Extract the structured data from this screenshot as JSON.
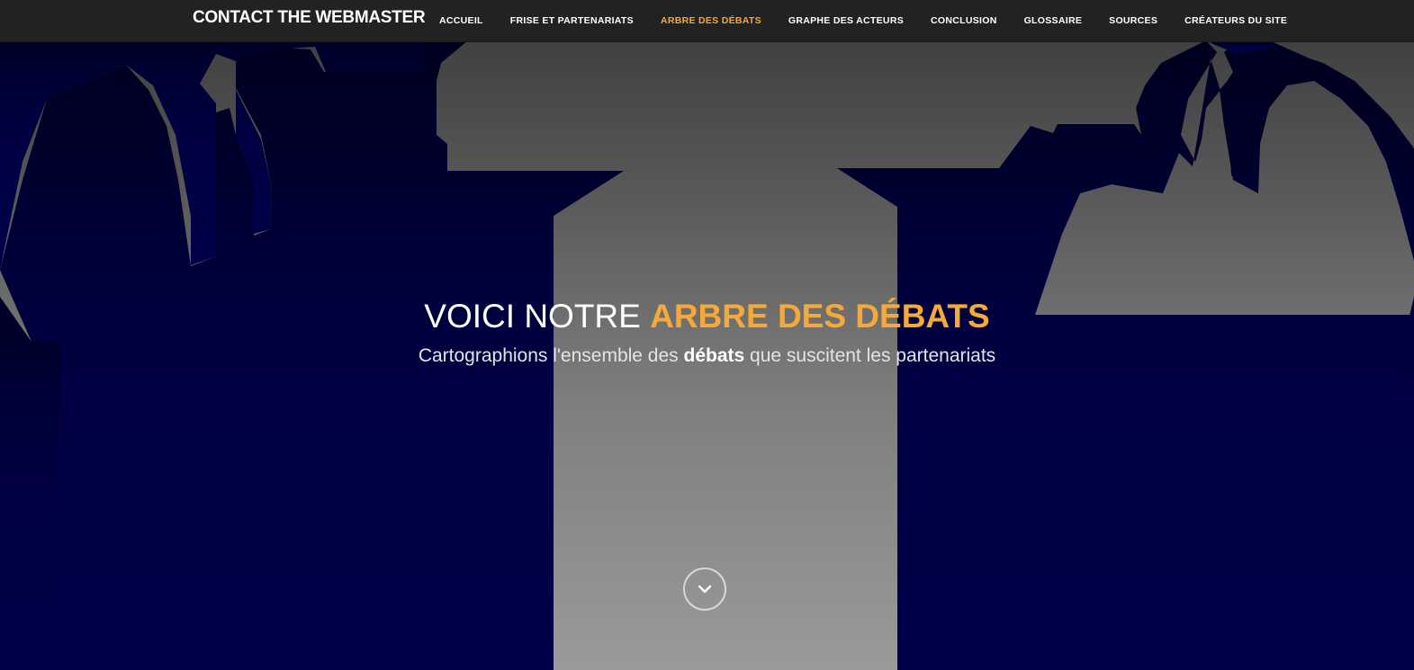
{
  "navbar": {
    "brand": "CONTACT THE WEBMASTER",
    "items": [
      {
        "label": "ACCUEIL",
        "active": false
      },
      {
        "label": "FRISE ET PARTENARIATS",
        "active": false
      },
      {
        "label": "ARBRE DES DÉBATS",
        "active": true
      },
      {
        "label": "GRAPHE DES ACTEURS",
        "active": false
      },
      {
        "label": "CONCLUSION",
        "active": false
      },
      {
        "label": "GLOSSAIRE",
        "active": false
      },
      {
        "label": "SOURCES",
        "active": false
      },
      {
        "label": "CRÉATEURS DU SITE",
        "active": false
      }
    ]
  },
  "hero": {
    "title_prefix": "VOICI NOTRE ",
    "title_accent": "ARBRE DES DÉBATS",
    "subtitle_before": "Cartographions l'ensemble des ",
    "subtitle_bold": "débats",
    "subtitle_after": " que suscitent les partenariats",
    "scroll_icon": "chevron-down-icon"
  },
  "colors": {
    "accent": "#f6a93b",
    "navbar_bg": "#222222",
    "silhouette": "#000033",
    "text": "#ffffff"
  }
}
